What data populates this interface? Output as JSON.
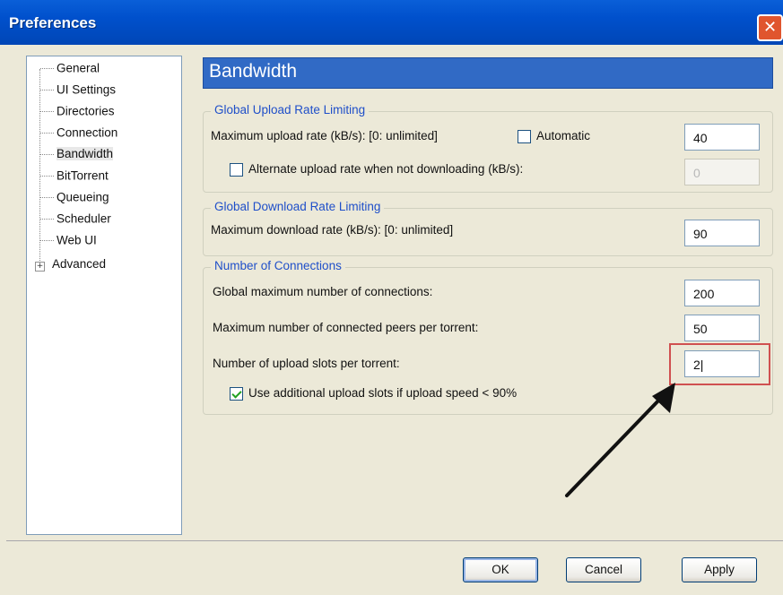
{
  "window": {
    "title": "Preferences",
    "close_symbol": "✕"
  },
  "sidebar": {
    "items": [
      {
        "label": "General"
      },
      {
        "label": "UI Settings"
      },
      {
        "label": "Directories"
      },
      {
        "label": "Connection"
      },
      {
        "label": "Bandwidth",
        "selected": true
      },
      {
        "label": "BitTorrent"
      },
      {
        "label": "Queueing"
      },
      {
        "label": "Scheduler"
      },
      {
        "label": "Web UI"
      },
      {
        "label": "Advanced",
        "expandable": true
      }
    ]
  },
  "panel": {
    "title": "Bandwidth",
    "upload": {
      "group_title": "Global Upload Rate Limiting",
      "max_label": "Maximum upload rate (kB/s): [0: unlimited]",
      "automatic_label": "Automatic",
      "automatic_checked": false,
      "max_value": "40",
      "alternate_label": "Alternate upload rate when not downloading (kB/s):",
      "alternate_checked": false,
      "alternate_value": "0"
    },
    "download": {
      "group_title": "Global Download Rate Limiting",
      "max_label": "Maximum download rate (kB/s): [0: unlimited]",
      "max_value": "90"
    },
    "connections": {
      "group_title": "Number of Connections",
      "global_label": "Global maximum number of connections:",
      "global_value": "200",
      "peers_label": "Maximum number of connected peers per torrent:",
      "peers_value": "50",
      "slots_label": "Number of upload slots per torrent:",
      "slots_value": "2|",
      "additional_label": "Use additional upload slots if upload speed < 90%",
      "additional_checked": true
    }
  },
  "footer": {
    "ok_label": "OK",
    "cancel_label": "Cancel",
    "apply_label": "Apply"
  },
  "colors": {
    "accent": "#316ac5",
    "group_title": "#1f4fc9",
    "highlight": "#d05050",
    "titlebar": "#0050cc"
  },
  "icons": {
    "close": "close-icon",
    "expander": "plus-icon",
    "annotation": "arrow-icon"
  }
}
